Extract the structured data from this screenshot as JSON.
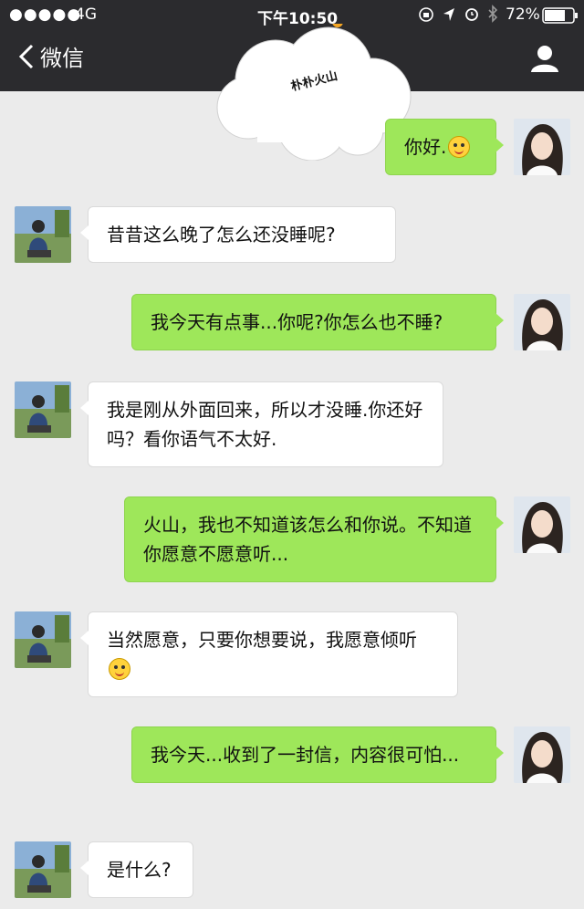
{
  "status_bar": {
    "signal": "●●●●●",
    "network": "4G",
    "time": "下午10:50",
    "battery": "72%"
  },
  "nav": {
    "back_label": "微信",
    "contact_name": "朴朴火山"
  },
  "messages": [
    {
      "side": "right",
      "text": "你好.",
      "emoji": true
    },
    {
      "side": "left",
      "text": "昔昔这么晚了怎么还没睡呢?"
    },
    {
      "side": "right",
      "text": "我今天有点事...你呢?你怎么也不睡?"
    },
    {
      "side": "left",
      "text": "我是刚从外面回来，所以才没睡.你还好吗？看你语气不太好."
    },
    {
      "side": "right",
      "text": "火山，我也不知道该怎么和你说。不知道你愿意不愿意听..."
    },
    {
      "side": "left",
      "text": "当然愿意，只要你想要说，我愿意倾听",
      "emoji": true
    },
    {
      "side": "right",
      "text": "我今天...收到了一封信，内容很可怕..."
    },
    {
      "side": "left",
      "text": "是什么?"
    }
  ],
  "colors": {
    "topbar": "#2b2b2e",
    "background": "#ebebeb",
    "bubble_sent": "#9ee75a",
    "bubble_received": "#ffffff"
  },
  "icons": [
    "back-chevron-icon",
    "person-icon",
    "alarm-icon",
    "location-icon",
    "bluetooth-icon",
    "battery-icon",
    "smile-emoji-icon"
  ]
}
